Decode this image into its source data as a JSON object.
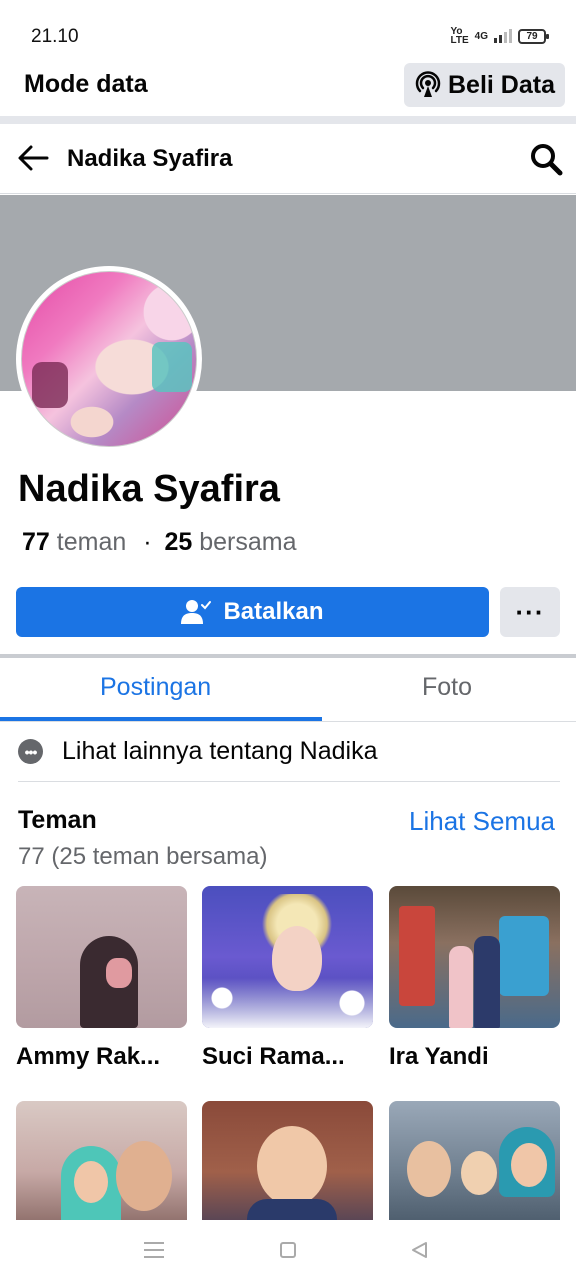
{
  "status_bar": {
    "time": "21.10",
    "network_top": "Yo",
    "network_bottom": "LTE",
    "network_type": "4G",
    "battery": "79"
  },
  "data_mode": {
    "label": "Mode data",
    "buy_button": "Beli Data"
  },
  "header": {
    "title": "Nadika Syafira",
    "back_icon": "arrow-left-icon",
    "search_icon": "search-icon"
  },
  "profile": {
    "name": "Nadika Syafira",
    "friend_count": "77",
    "friend_word": "teman",
    "separator": "·",
    "mutual_count": "25",
    "mutual_word": "bersama",
    "cancel_button": "Batalkan",
    "more_button": "···"
  },
  "tabs": [
    {
      "label": "Postingan",
      "active": true
    },
    {
      "label": "Foto",
      "active": false
    }
  ],
  "more_about": "Lihat lainnya tentang Nadika",
  "friends_section": {
    "title": "Teman",
    "see_all": "Lihat Semua",
    "subtitle": "77 (25 teman bersama)",
    "friends": [
      {
        "name": "Ammy Rak..."
      },
      {
        "name": "Suci Rama..."
      },
      {
        "name": "Ira Yandi"
      },
      {
        "name": ""
      },
      {
        "name": ""
      },
      {
        "name": ""
      }
    ]
  },
  "colors": {
    "accent": "#1b74e4",
    "cover": "#a5a9ad",
    "button_gray": "#e4e6eb",
    "secondary_text": "#65676b"
  }
}
